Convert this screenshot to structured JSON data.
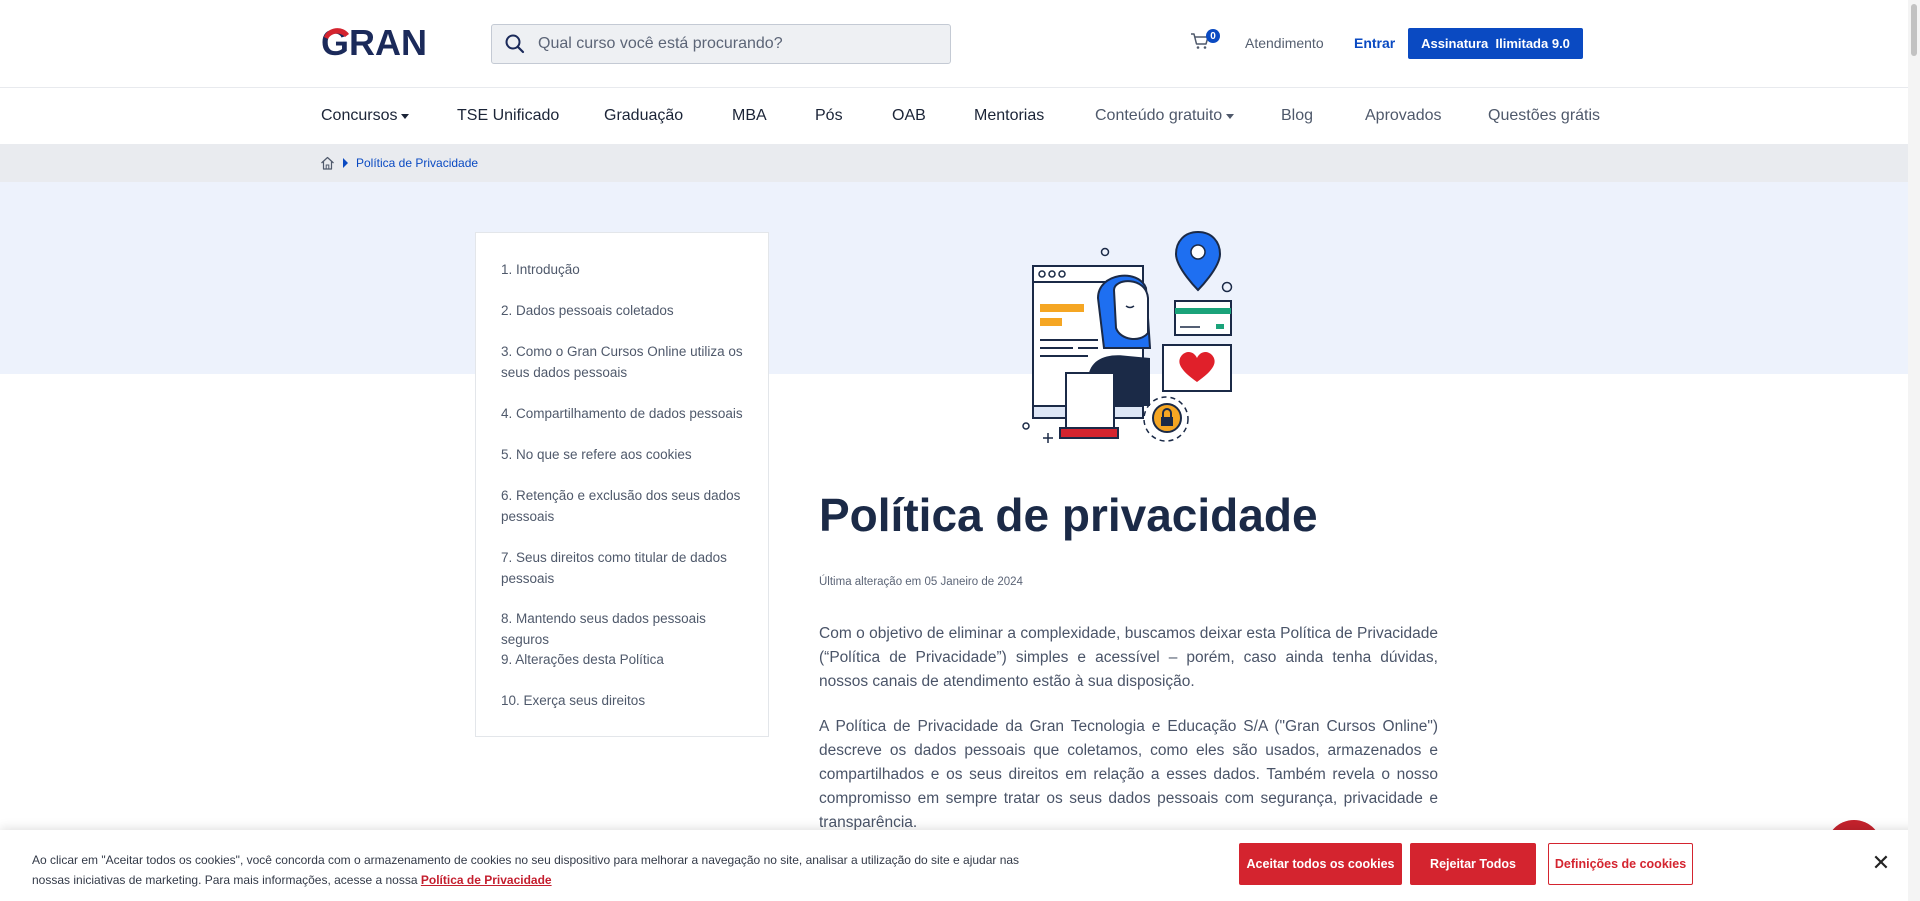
{
  "header": {
    "logo_text": "GRAN",
    "search_placeholder": "Qual curso você está procurando?",
    "cart_count": "0",
    "atendimento": "Atendimento",
    "entrar": "Entrar",
    "assinatura": "Assinatura  Ilimitada 9.0"
  },
  "nav": {
    "items": [
      "Concursos",
      "TSE Unificado",
      "Graduação",
      "MBA",
      "Pós",
      "OAB",
      "Mentorias",
      "Conteúdo gratuito",
      "Blog",
      "Aprovados",
      "Questões grátis"
    ]
  },
  "breadcrumb": {
    "current": "Política de Privacidade"
  },
  "toc": {
    "items": [
      "1. Introdução",
      "2. Dados pessoais coletados",
      "3. Como o Gran Cursos Online utiliza os seus dados pessoais",
      "4. Compartilhamento de dados pessoais",
      "5. No que se refere aos cookies",
      "6. Retenção e exclusão dos seus dados pessoais",
      "7. Seus direitos como titular de dados pessoais",
      "8. Mantendo seus dados pessoais seguros",
      "9. Alterações desta Política",
      "10. Exerça seus direitos"
    ]
  },
  "content": {
    "title": "Política de privacidade",
    "updated": "Última alteração em 05 Janeiro de 2024",
    "paragraphs": [
      "Com o objetivo de eliminar a complexidade, buscamos deixar esta Política de Privacidade (“Política de Privacidade”) simples e acessível – porém, caso ainda tenha dúvidas, nossos canais de atendimento estão à sua disposição.",
      "A Política de Privacidade da Gran Tecnologia e Educação S/A (\"Gran Cursos Online\") descreve os dados pessoais que coletamos, como eles são usados, armazenados e compartilhados e os seus direitos em relação a esses dados. Também revela o nosso compromisso em sempre tratar os seus dados pessoais com segurança, privacidade e transparência."
    ]
  },
  "cookie": {
    "text": "Ao clicar em \"Aceitar todos os cookies\", você concorda com o armazenamento de cookies no seu dispositivo para melhorar a navegação no site, analisar a utilização do site e ajudar nas nossas iniciativas de marketing. Para mais informações, acesse a nossa",
    "link": "Política de Privacidade",
    "accept": "Aceitar todos os cookies",
    "reject": "Rejeitar Todos",
    "settings": "Definições de cookies",
    "close": "✕"
  },
  "colors": {
    "brand_blue": "#0a4ac2",
    "brand_red": "#d4242f",
    "logo_navy": "#1b2a5a"
  }
}
